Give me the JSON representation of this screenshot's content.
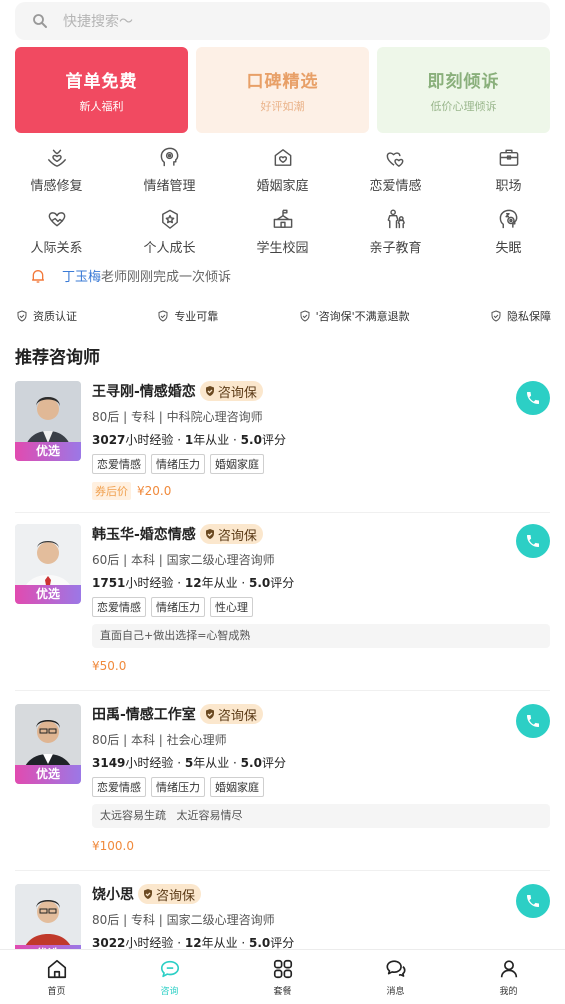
{
  "search": {
    "placeholder": "快捷搜索～"
  },
  "banners": [
    {
      "title": "首单免费",
      "subtitle": "新人福利"
    },
    {
      "title": "口碑精选",
      "subtitle": "好评如潮"
    },
    {
      "title": "即刻倾诉",
      "subtitle": "低价心理倾诉"
    }
  ],
  "categories": [
    {
      "label": "情感修复",
      "icon": "heart-hands-icon"
    },
    {
      "label": "情绪管理",
      "icon": "head-brain-icon"
    },
    {
      "label": "婚姻家庭",
      "icon": "home-heart-icon"
    },
    {
      "label": "恋爱情感",
      "icon": "double-heart-icon"
    },
    {
      "label": "职场",
      "icon": "briefcase-icon"
    },
    {
      "label": "人际关系",
      "icon": "handshake-icon"
    },
    {
      "label": "个人成长",
      "icon": "medal-icon"
    },
    {
      "label": "学生校园",
      "icon": "school-icon"
    },
    {
      "label": "亲子教育",
      "icon": "parent-child-icon"
    },
    {
      "label": "失眠",
      "icon": "sleep-head-icon"
    }
  ],
  "notice": {
    "name": "丁玉梅",
    "text": "老师刚刚完成一次倾诉"
  },
  "guarantees": [
    "资质认证",
    "专业可靠",
    "'咨询保'不满意退款",
    "隐私保障"
  ],
  "section_title": "推荐咨询师",
  "counselors": [
    {
      "name": "王寻刚-情感婚恋",
      "badge": "咨询保",
      "avatar_badge": "优选",
      "profile": "80后 | 专科 | 中科院心理咨询师",
      "hours": "3027",
      "hours_unit": "小时经验 · ",
      "years": "1",
      "years_unit": "年从业 · ",
      "rating": "5.0",
      "rating_unit": "评分",
      "tags": [
        "恋爱情感",
        "情绪压力",
        "婚姻家庭"
      ],
      "coupon_label": "券后价",
      "price": "¥20.0"
    },
    {
      "name": "韩玉华-婚恋情感",
      "badge": "咨询保",
      "avatar_badge": "优选",
      "profile": "60后 | 本科 | 国家二级心理咨询师",
      "hours": "1751",
      "hours_unit": "小时经验 · ",
      "years": "12",
      "years_unit": "年从业 · ",
      "rating": "5.0",
      "rating_unit": "评分",
      "tags": [
        "恋爱情感",
        "情绪压力",
        "性心理"
      ],
      "motto": "直面自己+做出选择=心智成熟",
      "price": "¥50.0"
    },
    {
      "name": "田禹-情感工作室",
      "badge": "咨询保",
      "avatar_badge": "优选",
      "profile": "80后 | 本科 | 社会心理师",
      "hours": "3149",
      "hours_unit": "小时经验 · ",
      "years": "5",
      "years_unit": "年从业 · ",
      "rating": "5.0",
      "rating_unit": "评分",
      "tags": [
        "恋爱情感",
        "情绪压力",
        "婚姻家庭"
      ],
      "motto": "太远容易生疏   太近容易情尽",
      "price": "¥100.0"
    },
    {
      "name": "饶小思",
      "badge": "咨询保",
      "avatar_badge": "优选",
      "profile": "80后 | 专科 | 国家二级心理咨询师",
      "hours": "3022",
      "hours_unit": "小时经验 · ",
      "years": "12",
      "years_unit": "年从业 · ",
      "rating": "5.0",
      "rating_unit": "评分"
    }
  ],
  "tabs": [
    {
      "label": "首页",
      "icon": "home-icon"
    },
    {
      "label": "咨询",
      "icon": "chat-bubble-icon",
      "active": true
    },
    {
      "label": "套餐",
      "icon": "grid-icon"
    },
    {
      "label": "消息",
      "icon": "messages-icon"
    },
    {
      "label": "我的",
      "icon": "user-icon"
    }
  ],
  "colors": {
    "accent": "#2ccfc5",
    "banner_red": "#f14a61",
    "price_orange": "#f08a3c",
    "link_blue": "#3b7bd6"
  }
}
